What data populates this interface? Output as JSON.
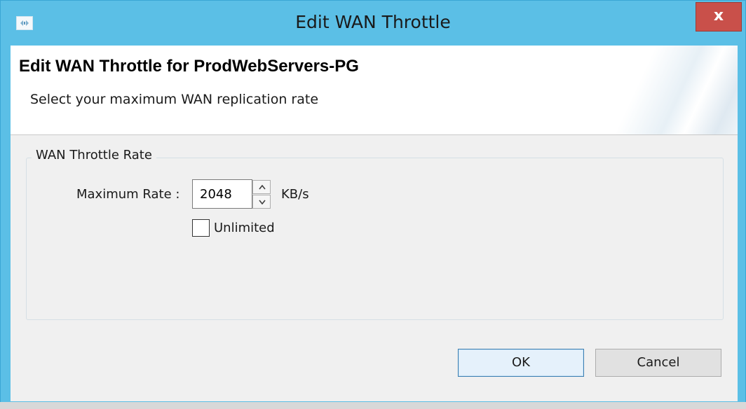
{
  "window": {
    "title": "Edit WAN Throttle",
    "close_glyph": "x",
    "icon": "app-icon",
    "accent_color": "#5bbfe6",
    "close_color": "#c9504a"
  },
  "banner": {
    "title": "Edit WAN Throttle for ProdWebServers-PG",
    "subtitle": "Select your maximum WAN replication rate"
  },
  "group": {
    "legend": "WAN Throttle Rate",
    "rate_label": "Maximum Rate :",
    "rate_value": "2048",
    "unit": "KB/s",
    "unlimited_label": "Unlimited",
    "unlimited_checked": false
  },
  "buttons": {
    "ok": "OK",
    "cancel": "Cancel"
  }
}
